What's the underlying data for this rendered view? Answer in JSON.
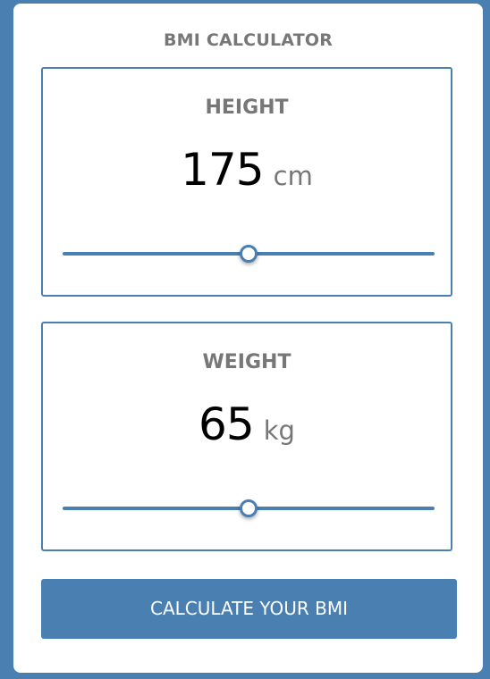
{
  "app": {
    "title": "BMI CALCULATOR"
  },
  "height": {
    "label": "HEIGHT",
    "value": "175",
    "unit": "cm",
    "slider_fraction": 0.5
  },
  "weight": {
    "label": "WEIGHT",
    "value": "65",
    "unit": "kg",
    "slider_fraction": 0.5
  },
  "actions": {
    "calculate_label": "CALCULATE YOUR BMI"
  },
  "colors": {
    "accent": "#4a7fb2",
    "label_gray": "#777777",
    "card_bg": "#ffffff"
  }
}
